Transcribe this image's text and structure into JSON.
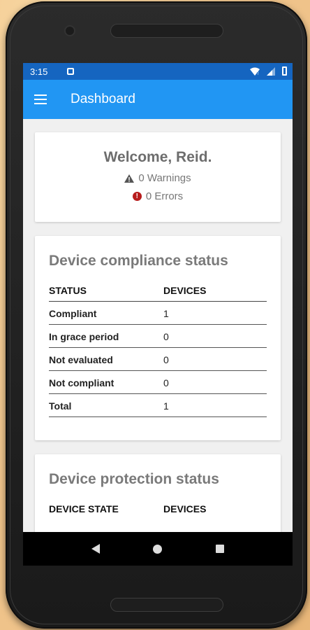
{
  "statusbar": {
    "time": "3:15"
  },
  "appbar": {
    "title": "Dashboard"
  },
  "welcome": {
    "title": "Welcome, Reid.",
    "warnings": "0 Warnings",
    "errors": "0 Errors"
  },
  "compliance": {
    "title": "Device compliance status",
    "headers": [
      "STATUS",
      "DEVICES"
    ],
    "rows": [
      {
        "status": "Compliant",
        "devices": "1"
      },
      {
        "status": "In grace period",
        "devices": "0"
      },
      {
        "status": "Not evaluated",
        "devices": "0"
      },
      {
        "status": "Not compliant",
        "devices": "0"
      },
      {
        "status": "Total",
        "devices": "1"
      }
    ]
  },
  "protection": {
    "title": "Device protection status",
    "headers": [
      "DEVICE STATE",
      "DEVICES"
    ]
  },
  "colors": {
    "statusbar": "#1565c0",
    "appbar": "#2196f3",
    "error": "#b71c1c"
  }
}
